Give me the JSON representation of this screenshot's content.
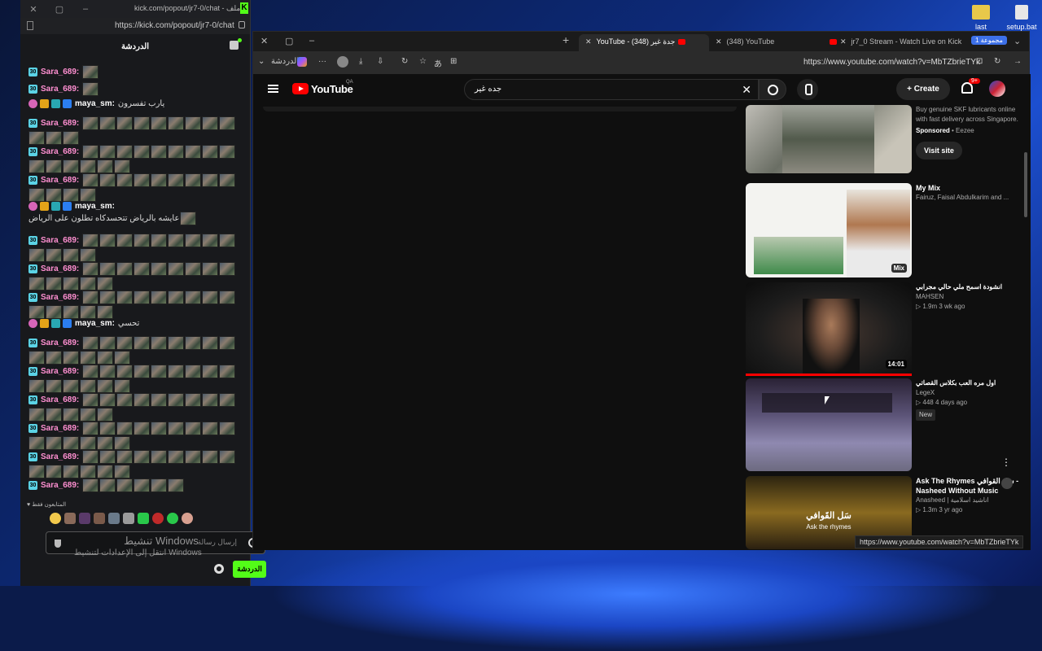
{
  "desktop": {
    "icons": [
      {
        "label": "last",
        "color": "#e8c84a"
      },
      {
        "label": "setup.bat",
        "color": "#e6e6e6"
      }
    ]
  },
  "popout": {
    "title": "kick.com/popout/jr7-0/chat - ملف ...",
    "url": "https://kick.com/popout/jr7-0/chat",
    "chat_title": "الدردشة",
    "messages": [
      {
        "user": "Sara_689:",
        "type": "sub",
        "emotes": 1,
        "text": ""
      },
      {
        "user": "Sara_689:",
        "type": "sub",
        "emotes": 1,
        "text": ""
      },
      {
        "user": "maya_sm:",
        "type": "vip",
        "emotes": 0,
        "text": "يارب تفسرون"
      },
      {
        "user": "Sara_689:",
        "type": "sub",
        "emotes": 12,
        "text": ""
      },
      {
        "user": "Sara_689:",
        "type": "sub",
        "emotes": 15,
        "text": ""
      },
      {
        "user": "Sara_689:",
        "type": "sub",
        "emotes": 13,
        "text": ""
      },
      {
        "user": "maya_sm:",
        "type": "vip",
        "emotes": 1,
        "text": "عايشه بالرياض تتحسدكاه تطلون على الرياض"
      },
      {
        "user": "Sara_689:",
        "type": "sub",
        "emotes": 13,
        "text": ""
      },
      {
        "user": "Sara_689:",
        "type": "sub",
        "emotes": 14,
        "text": ""
      },
      {
        "user": "Sara_689:",
        "type": "sub",
        "emotes": 14,
        "text": ""
      },
      {
        "user": "maya_sm:",
        "type": "vip",
        "emotes": 0,
        "text": "تحسي"
      },
      {
        "user": "Sara_689:",
        "type": "sub",
        "emotes": 15,
        "text": ""
      },
      {
        "user": "Sara_689:",
        "type": "sub",
        "emotes": 15,
        "text": ""
      },
      {
        "user": "Sara_689:",
        "type": "sub",
        "emotes": 14,
        "text": ""
      },
      {
        "user": "Sara_689:",
        "type": "sub",
        "emotes": 15,
        "text": ""
      },
      {
        "user": "Sara_689:",
        "type": "sub",
        "emotes": 15,
        "text": ""
      },
      {
        "user": "Sara_689:",
        "type": "sub",
        "emotes": 6,
        "text": ""
      }
    ],
    "viewers_label": "المتابعون فقط",
    "input_placeholder": "إرسال رسالة",
    "watermark_line1": "تنشيط Windows",
    "watermark_line2": "انتقل إلى الإعدادات لتنشيط Windows",
    "send_label": "الدردشة"
  },
  "browser": {
    "sidebar_label": "الدردشة",
    "tabs": [
      {
        "label": "YouTube - جدة غير (348)",
        "active": true
      },
      {
        "label": "(348) YouTube",
        "active": false
      },
      {
        "label": "jr7_0 Stream - Watch Live on Kick",
        "active": false
      }
    ],
    "group_label": "مجموعة 1",
    "url": "https://www.youtube.com/watch?v=MbTZbrieTYk",
    "status_url": "https://www.youtube.com/watch?v=MbTZbrieTYk"
  },
  "youtube": {
    "logo_text": "YouTube",
    "region": "QA",
    "search_query": "جده غير",
    "create_label": "Create",
    "notifications": "9+",
    "recommendations": [
      {
        "title": "",
        "lines": [
          "Buy genuine SKF lubricants online with fast delivery across Singapore."
        ],
        "sponsor": "Sponsored",
        "sponsor_name": "Eezee",
        "button": "Visit site",
        "duration": ""
      },
      {
        "title": "My Mix",
        "lines": [
          "Fairuz, Faisal Abdulkarim and ..."
        ],
        "duration": "Mix"
      },
      {
        "title": "انشودة اسمح ملي حالي مجرابي",
        "lines": [
          "MAHSEN",
          "▷ 1.9m   3 wk ago"
        ],
        "duration": "14:01"
      },
      {
        "title": "اول مره العب بكلاس القصاتي",
        "lines": [
          "LegeX",
          "▷ 448   4 days ago"
        ],
        "badge": "New",
        "duration": ""
      },
      {
        "title": "Ask The Rhymes سل القوافي - Nasheed Without Music",
        "lines": [
          "Anasheed | اناشيد اسلامية",
          "▷ 1.3m   3 yr ago"
        ],
        "duration": "",
        "thumb_text1": "سَل القَوافي",
        "thumb_text2": "Ask the rhymes"
      }
    ]
  }
}
